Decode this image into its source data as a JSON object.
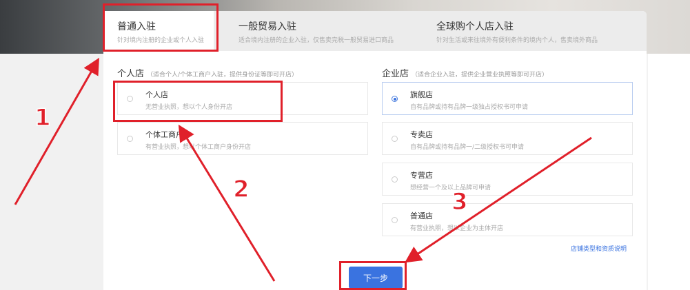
{
  "tabs": [
    {
      "title": "普通入驻",
      "subtitle": "针对境内注册的企业或个人入驻",
      "active": true
    },
    {
      "title": "一般贸易入驻",
      "subtitle": "适合境内注册的企业入驻，仅售卖完税一般贸易进口商品",
      "active": false
    },
    {
      "title": "全球购个人店入驻",
      "subtitle": "针对生活或来往境外有便利条件的境内个人，售卖境外商品",
      "active": false
    }
  ],
  "personal_section": {
    "title": "个人店",
    "hint": "（适合个人/个体工商户入驻，提供身份证等即可开店）",
    "options": [
      {
        "name": "个人店",
        "desc": "无营业执照，想以个人身份开店",
        "selected": false
      },
      {
        "name": "个体工商户",
        "desc": "有营业执照，想以个体工商户身份开店",
        "selected": false
      }
    ]
  },
  "enterprise_section": {
    "title": "企业店",
    "hint": "（适合企业入驻，提供企业营业执照等即可开店）",
    "options": [
      {
        "name": "旗舰店",
        "desc": "自有品牌或持有品牌一级独占授权书可申请",
        "selected": true
      },
      {
        "name": "专卖店",
        "desc": "自有品牌或持有品牌一/二级授权书可申请",
        "selected": false
      },
      {
        "name": "专营店",
        "desc": "想经营一个及以上品牌可申请",
        "selected": false
      },
      {
        "name": "普通店",
        "desc": "有营业执照，想以企业为主体开店",
        "selected": false
      }
    ]
  },
  "store_type_link": "店铺类型和资质说明",
  "next_button": "下一步",
  "annotations": {
    "step1": "1",
    "step2": "2",
    "step3": "3"
  },
  "colors": {
    "accent": "#3a73e0",
    "highlight": "#e0202a"
  }
}
